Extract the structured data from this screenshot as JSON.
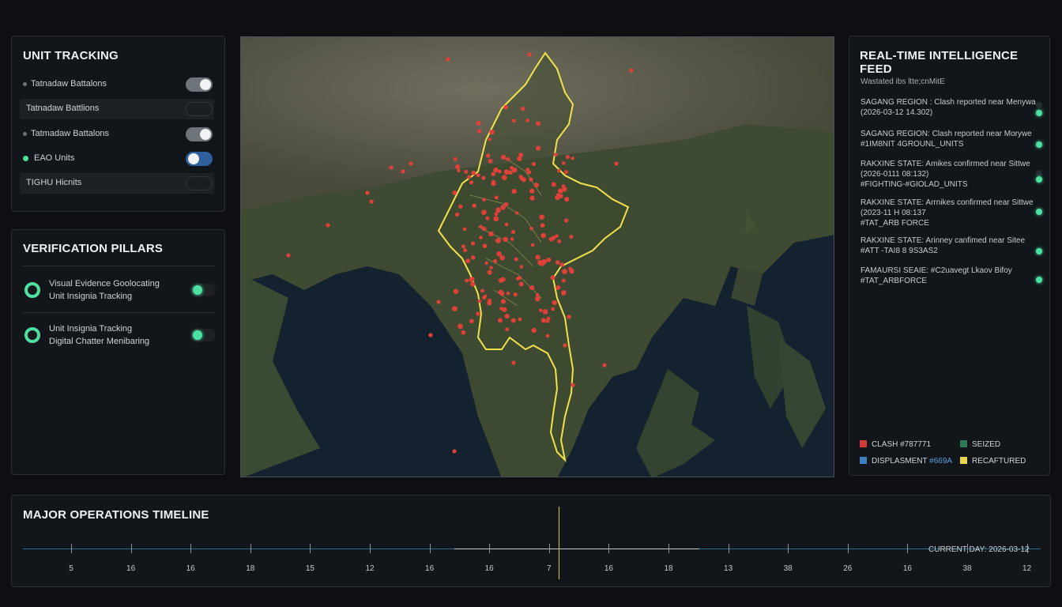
{
  "unit_tracking": {
    "title": "UNIT TRACKING",
    "rows": [
      {
        "label": "Tatnadaw Battalons",
        "state": "on"
      },
      {
        "label": "Tatnadaw Battlions",
        "state": "off"
      },
      {
        "label": "Tatmadaw Battalons",
        "state": "on"
      },
      {
        "label": "EAO Units",
        "state": "blue"
      },
      {
        "label": "TIGHU Hicnits",
        "state": "off"
      }
    ]
  },
  "verification": {
    "title": "VERIFICATION PILLARS",
    "items": [
      {
        "line1": "Visual Evidence Goolocating",
        "line2": "Unit Insignia Tracking"
      },
      {
        "line1": "Unit Insignia Tracking",
        "line2": "Digital Chatter Menibaring"
      }
    ]
  },
  "feed": {
    "title": "REAL-TIME INTELLIGENCE FEED",
    "subtitle": "Wastated ibs ltte;cnMitE",
    "items": [
      {
        "l1": "SAGANG REGION : Clash reported near Menywa",
        "l2": "(2026-03-12 14.302)",
        "status": "active"
      },
      {
        "l1": "SAGANG REGION: Clash reported near Morywe",
        "l2": "#1IM8NIT 4GROUNL_UNITS",
        "status": "active"
      },
      {
        "l1": "RAKXINE STATE: Amikes confirmed near Sittwe",
        "l2": "(2026-0111 08:132)",
        "l3": "#FIGHTING-#GIOLAD_UNITS",
        "status": "active"
      },
      {
        "l1": "RAKXINE STATE: Arrnikes confirmed near Sittwe",
        "l2": "(2023-11 H 08:137",
        "l3": "#TAT_ARB FORCE",
        "status": "active"
      },
      {
        "l1": "RAKXINE STATE: Arinney canfimed near Sitee",
        "l2": "#ATT -TAI8 8 9S3AS2",
        "status": "active"
      },
      {
        "l1": "FAMAURSI SEAIE: #C2uavegt Lkaov Bifoy",
        "l2": "#TAT_ARBFORCE",
        "status": "active"
      }
    ],
    "legend": [
      {
        "label": "CLASH #787771",
        "color": "#d33a3a"
      },
      {
        "label": "SEIZED",
        "color": "#2f7a55"
      },
      {
        "label": "DISPLASMENT",
        "suffix": "#669A",
        "color": "#3d7fc0"
      },
      {
        "label": "RECAFTURED",
        "color": "#e9d54a"
      }
    ]
  },
  "timeline": {
    "title": "MAJOR OPERATIONS TIMELINE",
    "current_label": "CURRENT DAY: 2026-03-12",
    "labels": [
      "5",
      "16",
      "16",
      "18",
      "15",
      "12",
      "16",
      "16",
      "7",
      "16",
      "18",
      "13",
      "38",
      "26",
      "16",
      "38",
      "12"
    ],
    "current_fraction": 0.503
  },
  "colors": {
    "accent": "#4ee0a0",
    "border_highlight": "#f2e24a",
    "marker": "#e0403a"
  }
}
